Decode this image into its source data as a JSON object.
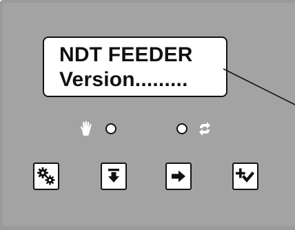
{
  "display": {
    "line1": "NDT FEEDER",
    "line2": "Version........."
  },
  "indicators": {
    "manual": {
      "icon": "hand-icon",
      "state": "off"
    },
    "auto": {
      "icon": "cycle-icon",
      "state": "off"
    }
  },
  "buttons": [
    {
      "id": "settings",
      "icon": "gears-icon"
    },
    {
      "id": "down",
      "icon": "arrow-down-to-bar-icon"
    },
    {
      "id": "forward",
      "icon": "arrow-right-icon"
    },
    {
      "id": "add-confirm",
      "icon": "plus-check-icon"
    }
  ],
  "colors": {
    "panel": "#a3a3a3",
    "panel_edge": "#9a9a9a",
    "display_bg": "#ffffff",
    "text": "#111111",
    "indicator_icon": "#ffffff"
  }
}
